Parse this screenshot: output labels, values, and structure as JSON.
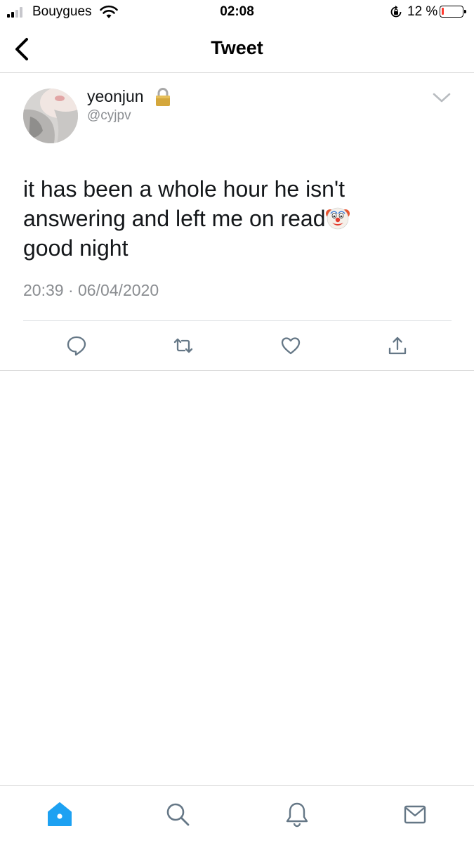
{
  "status_bar": {
    "carrier": "Bouygues",
    "time": "02:08",
    "battery_percent": "12 %",
    "battery_level": 0.12,
    "icons": [
      "signal-icon",
      "wifi-icon",
      "rotation-lock-icon",
      "battery-icon"
    ]
  },
  "nav": {
    "title": "Tweet",
    "back_icon": "chevron-left-icon"
  },
  "tweet": {
    "display_name": "yeonjun",
    "protected_icon": "lock-icon",
    "handle": "@cyjpv",
    "text_lines": [
      "it has been a whole hour he isn't",
      "answering and left me on read",
      "good night"
    ],
    "emoji": "clown-face-emoji",
    "timestamp": "20:39 · 06/04/2020",
    "more_icon": "chevron-down-icon",
    "actions": [
      "reply-icon",
      "retweet-icon",
      "like-icon",
      "share-icon"
    ]
  },
  "tab_bar": {
    "active": "home",
    "tabs": [
      "home-icon",
      "search-icon",
      "notifications-icon",
      "messages-icon"
    ]
  },
  "colors": {
    "accent": "#1da1f2",
    "action_gray": "#657786",
    "secondary_text": "#8a8d91",
    "divider": "#d9d9d9"
  }
}
